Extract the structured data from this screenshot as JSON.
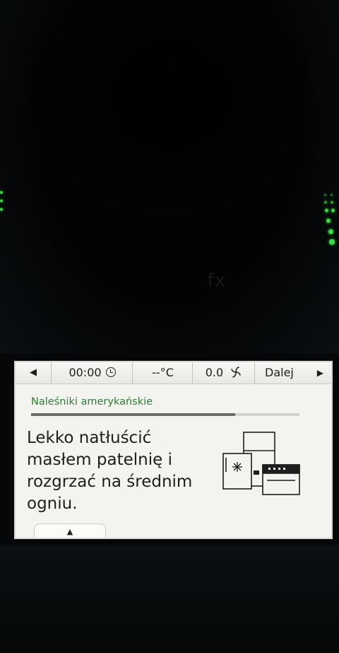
{
  "device": {
    "brand_text": "fx"
  },
  "status_bar": {
    "back_symbol": "◀",
    "timer": "00:00",
    "temperature": "--°C",
    "speed": "0.0",
    "next_label": "Dalej",
    "next_symbol": "▶"
  },
  "recipe": {
    "title": "Naleśniki amerykańskie",
    "progress": 0.76
  },
  "instruction": {
    "text": "Lekko natłuścić\nmasłem patelnię i\nrozgrzać na średnim\nogniu."
  },
  "bottom_tab": {
    "symbol": "▲"
  },
  "colors": {
    "accent_green": "#2e7d32",
    "screen_bg": "#f3f3f0",
    "led_green": "#3ed846"
  },
  "icons": {
    "timer": "clock-icon",
    "speed": "fan-icon",
    "illustration": "fridge-and-oven-icon"
  }
}
